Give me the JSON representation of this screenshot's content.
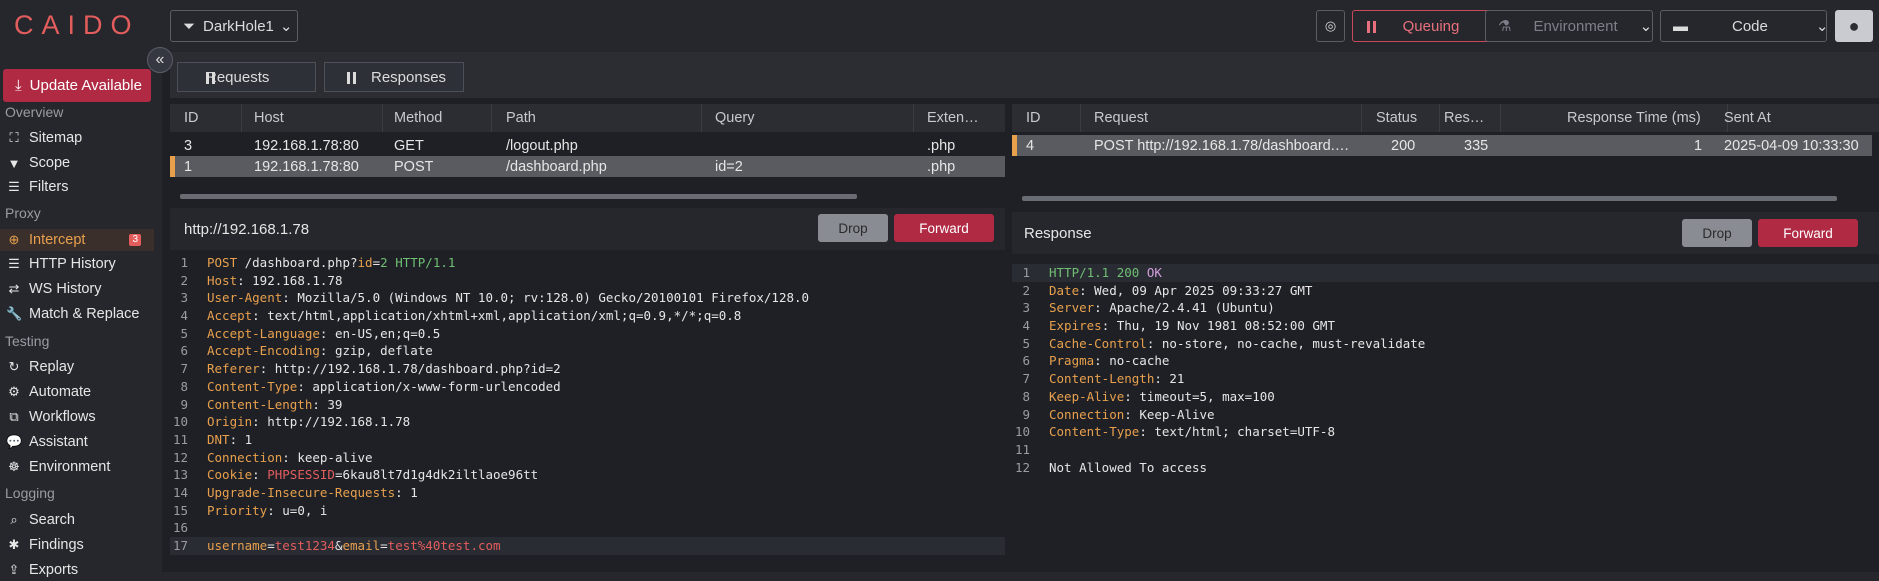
{
  "app": {
    "logo": "CAIDO"
  },
  "topbar": {
    "scope_label": "DarkHole1",
    "queue_label": "Queuing",
    "environment_label": "Environment",
    "code_label": "Code"
  },
  "sidebar": {
    "update_label": "Update Available",
    "sections": {
      "overview": "Overview",
      "proxy": "Proxy",
      "testing": "Testing",
      "logging": "Logging"
    },
    "items": [
      {
        "label": "Sitemap",
        "icon": "sitemap-icon"
      },
      {
        "label": "Scope",
        "icon": "filter-icon"
      },
      {
        "label": "Filters",
        "icon": "sliders-icon"
      },
      {
        "label": "Intercept",
        "icon": "crosshair-icon",
        "badge": "3"
      },
      {
        "label": "HTTP History",
        "icon": "list-icon"
      },
      {
        "label": "WS History",
        "icon": "swap-icon"
      },
      {
        "label": "Match & Replace",
        "icon": "wrench-icon"
      },
      {
        "label": "Replay",
        "icon": "replay-icon"
      },
      {
        "label": "Automate",
        "icon": "cpu-icon"
      },
      {
        "label": "Workflows",
        "icon": "workflow-icon"
      },
      {
        "label": "Assistant",
        "icon": "chat-icon"
      },
      {
        "label": "Environment",
        "icon": "environment-icon"
      },
      {
        "label": "Search",
        "icon": "search-icon"
      },
      {
        "label": "Findings",
        "icon": "findings-icon"
      },
      {
        "label": "Exports",
        "icon": "export-icon"
      }
    ]
  },
  "modes": {
    "requests": "Requests",
    "responses": "Responses"
  },
  "requests_table": {
    "columns": [
      "ID",
      "Host",
      "Method",
      "Path",
      "Query",
      "Exten…"
    ],
    "rows": [
      {
        "id": "3",
        "host": "192.168.1.78:80",
        "method": "GET",
        "path": "/logout.php",
        "query": "",
        "ext": ".php"
      },
      {
        "id": "1",
        "host": "192.168.1.78:80",
        "method": "POST",
        "path": "/dashboard.php",
        "query": "id=2",
        "ext": ".php"
      }
    ]
  },
  "responses_table": {
    "columns": [
      "ID",
      "Request",
      "Status",
      "Res…",
      "Response Time (ms)",
      "Sent At"
    ],
    "rows": [
      {
        "id": "4",
        "request": "POST http://192.168.1.78/dashboard.…",
        "status": "200",
        "length": "335",
        "time": "1",
        "sent_at": "2025-04-09 10:33:30"
      }
    ]
  },
  "request_pane": {
    "title": "http://192.168.1.78",
    "drop_label": "Drop",
    "forward_label": "Forward",
    "lines": [
      {
        "n": "1",
        "parts": [
          [
            "m",
            "POST"
          ],
          [
            "w",
            " /dashboard.php?"
          ],
          [
            "k",
            "id"
          ],
          [
            "w",
            "="
          ],
          [
            "v",
            "2"
          ],
          [
            "w",
            " "
          ],
          [
            "v",
            "HTTP/1.1"
          ]
        ]
      },
      {
        "n": "2",
        "parts": [
          [
            "k",
            "Host"
          ],
          [
            "w",
            ": 192.168.1.78"
          ]
        ]
      },
      {
        "n": "3",
        "parts": [
          [
            "k",
            "User-Agent"
          ],
          [
            "w",
            ": Mozilla/5.0 (Windows NT 10.0; rv:128.0) Gecko/20100101 Firefox/128.0"
          ]
        ]
      },
      {
        "n": "4",
        "parts": [
          [
            "k",
            "Accept"
          ],
          [
            "w",
            ": text/html,application/xhtml+xml,application/xml;q=0.9,*/*;q=0.8"
          ]
        ]
      },
      {
        "n": "5",
        "parts": [
          [
            "k",
            "Accept-Language"
          ],
          [
            "w",
            ": en-US,en;q=0.5"
          ]
        ]
      },
      {
        "n": "6",
        "parts": [
          [
            "k",
            "Accept-Encoding"
          ],
          [
            "w",
            ": gzip, deflate"
          ]
        ]
      },
      {
        "n": "7",
        "parts": [
          [
            "k",
            "Referer"
          ],
          [
            "w",
            ": http://192.168.1.78/dashboard.php?id=2"
          ]
        ]
      },
      {
        "n": "8",
        "parts": [
          [
            "k",
            "Content-Type"
          ],
          [
            "w",
            ": application/x-www-form-urlencoded"
          ]
        ]
      },
      {
        "n": "9",
        "parts": [
          [
            "k",
            "Content-Length"
          ],
          [
            "w",
            ": 39"
          ]
        ]
      },
      {
        "n": "10",
        "parts": [
          [
            "k",
            "Origin"
          ],
          [
            "w",
            ": http://192.168.1.78"
          ]
        ]
      },
      {
        "n": "11",
        "parts": [
          [
            "k",
            "DNT"
          ],
          [
            "w",
            ": 1"
          ]
        ]
      },
      {
        "n": "12",
        "parts": [
          [
            "k",
            "Connection"
          ],
          [
            "w",
            ": keep-alive"
          ]
        ]
      },
      {
        "n": "13",
        "parts": [
          [
            "k",
            "Cookie"
          ],
          [
            "w",
            ": "
          ],
          [
            "s",
            "PHPSESSID"
          ],
          [
            "w",
            "=6kau8lt7d1g4dk2iltlaoe96tt"
          ]
        ]
      },
      {
        "n": "14",
        "parts": [
          [
            "k",
            "Upgrade-Insecure-Requests"
          ],
          [
            "w",
            ": 1"
          ]
        ]
      },
      {
        "n": "15",
        "parts": [
          [
            "k",
            "Priority"
          ],
          [
            "w",
            ": u=0, i"
          ]
        ]
      },
      {
        "n": "16",
        "parts": []
      },
      {
        "n": "17",
        "parts": [
          [
            "k",
            "username"
          ],
          [
            "w",
            "="
          ],
          [
            "s",
            "test1234"
          ],
          [
            "w",
            "&"
          ],
          [
            "k",
            "email"
          ],
          [
            "w",
            "="
          ],
          [
            "s",
            "test%40test.com"
          ]
        ]
      }
    ]
  },
  "response_pane": {
    "title": "Response",
    "drop_label": "Drop",
    "forward_label": "Forward",
    "lines": [
      {
        "n": "1",
        "parts": [
          [
            "v",
            "HTTP/1.1"
          ],
          [
            "w",
            " "
          ],
          [
            "v",
            "200"
          ],
          [
            "w",
            " "
          ],
          [
            "o",
            "OK"
          ]
        ]
      },
      {
        "n": "2",
        "parts": [
          [
            "k",
            "Date"
          ],
          [
            "w",
            ": Wed, 09 Apr 2025 09:33:27 GMT"
          ]
        ]
      },
      {
        "n": "3",
        "parts": [
          [
            "k",
            "Server"
          ],
          [
            "w",
            ": Apache/2.4.41 (Ubuntu)"
          ]
        ]
      },
      {
        "n": "4",
        "parts": [
          [
            "k",
            "Expires"
          ],
          [
            "w",
            ": Thu, 19 Nov 1981 08:52:00 GMT"
          ]
        ]
      },
      {
        "n": "5",
        "parts": [
          [
            "k",
            "Cache-Control"
          ],
          [
            "w",
            ": no-store, no-cache, must-revalidate"
          ]
        ]
      },
      {
        "n": "6",
        "parts": [
          [
            "k",
            "Pragma"
          ],
          [
            "w",
            ": no-cache"
          ]
        ]
      },
      {
        "n": "7",
        "parts": [
          [
            "k",
            "Content-Length"
          ],
          [
            "w",
            ": 21"
          ]
        ]
      },
      {
        "n": "8",
        "parts": [
          [
            "k",
            "Keep-Alive"
          ],
          [
            "w",
            ": timeout=5, max=100"
          ]
        ]
      },
      {
        "n": "9",
        "parts": [
          [
            "k",
            "Connection"
          ],
          [
            "w",
            ": Keep-Alive"
          ]
        ]
      },
      {
        "n": "10",
        "parts": [
          [
            "k",
            "Content-Type"
          ],
          [
            "w",
            ": text/html; charset=UTF-8"
          ]
        ]
      },
      {
        "n": "11",
        "parts": []
      },
      {
        "n": "12",
        "parts": [
          [
            "w",
            "Not Allowed To access"
          ]
        ]
      }
    ]
  }
}
